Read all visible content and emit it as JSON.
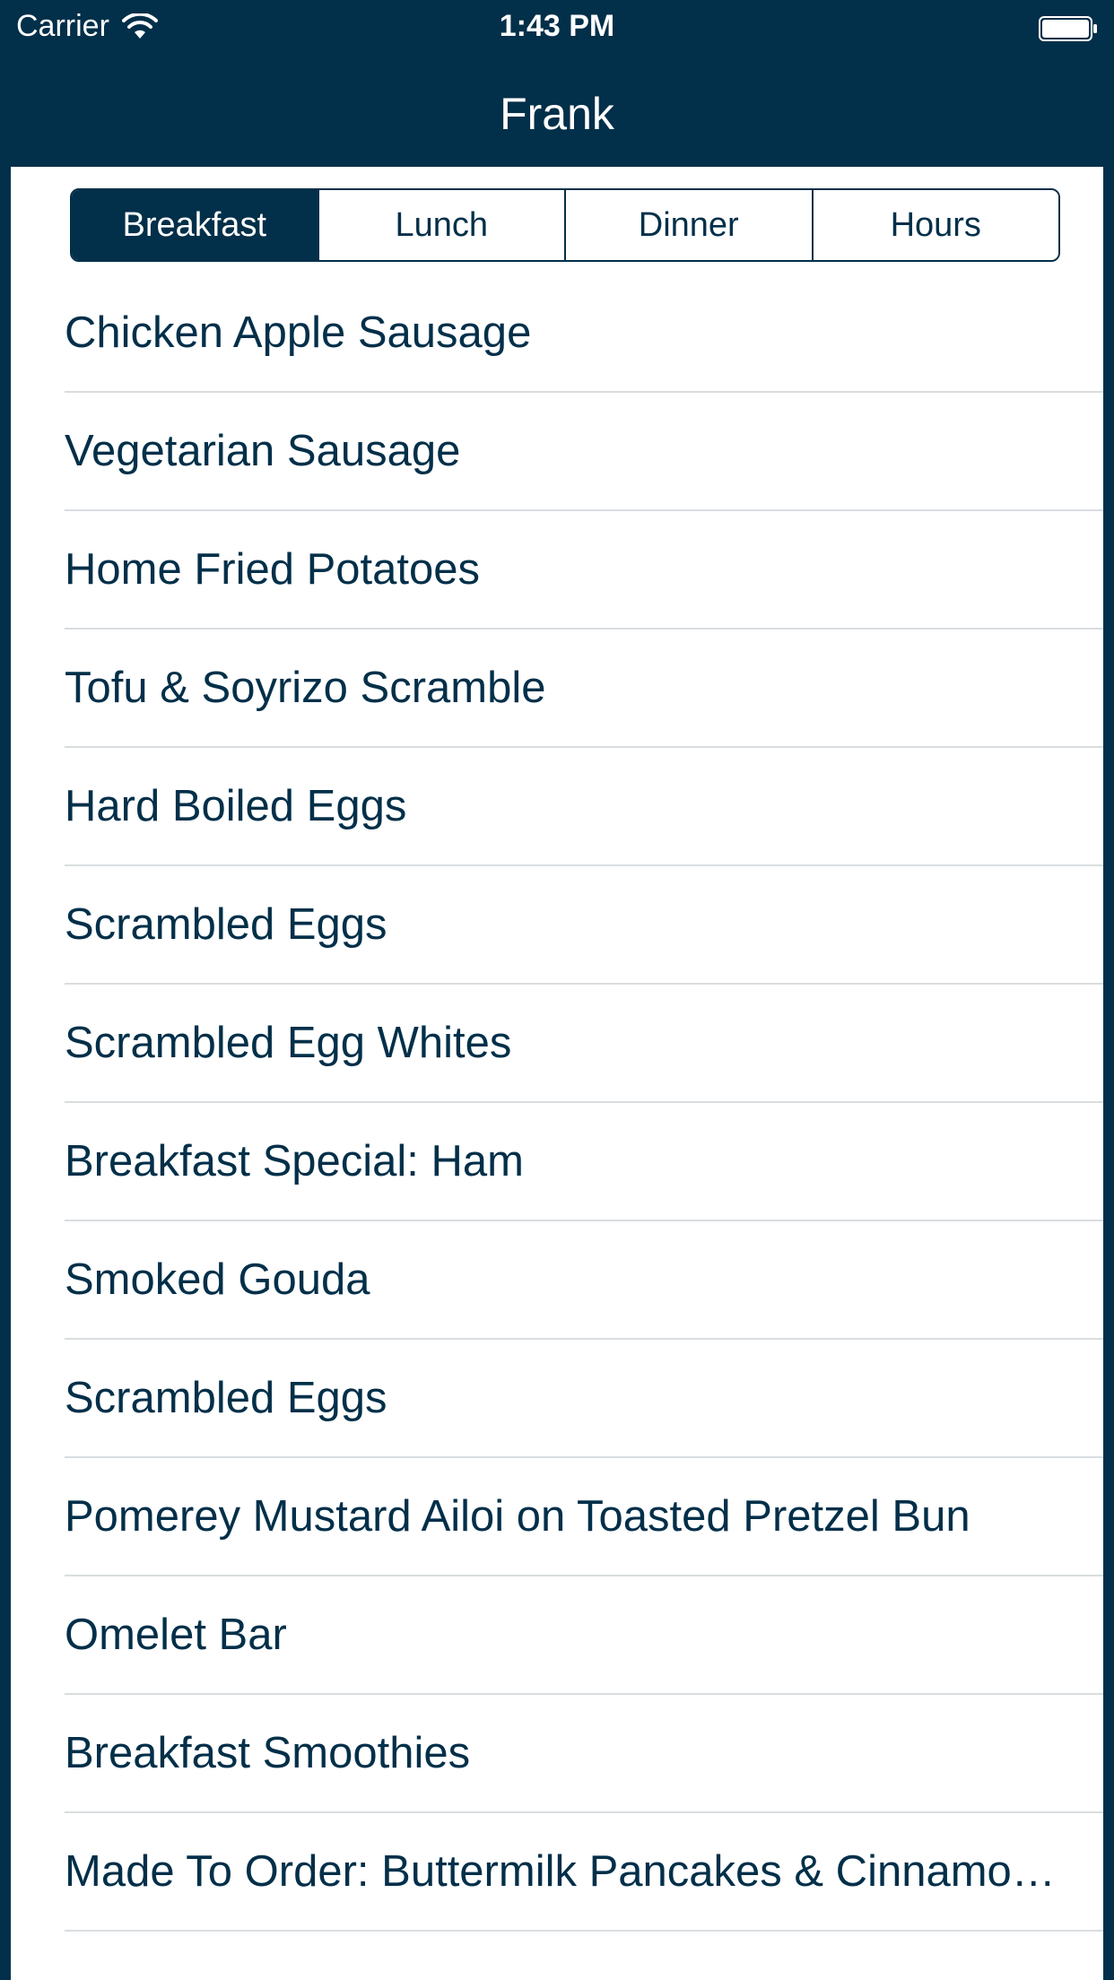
{
  "status_bar": {
    "carrier": "Carrier",
    "time": "1:43 PM",
    "icons": [
      "wifi-icon",
      "battery-icon"
    ]
  },
  "nav": {
    "title": "Frank"
  },
  "segments": [
    {
      "label": "Breakfast",
      "selected": true
    },
    {
      "label": "Lunch",
      "selected": false
    },
    {
      "label": "Dinner",
      "selected": false
    },
    {
      "label": "Hours",
      "selected": false
    }
  ],
  "menu_items": [
    "Chicken Apple Sausage",
    "Vegetarian Sausage",
    "Home Fried Potatoes",
    "Tofu & Soyrizo Scramble",
    "Hard Boiled Eggs",
    "Scrambled Eggs",
    "Scrambled Egg Whites",
    "Breakfast Special: Ham",
    "Smoked Gouda",
    "Scrambled Eggs",
    "Pomerey Mustard Ailoi on Toasted Pretzel Bun",
    "Omelet Bar",
    "Breakfast Smoothies",
    "Made To Order: Buttermilk Pancakes & Cinnamon French Toast"
  ],
  "colors": {
    "brand": "#022f49",
    "background": "#ffffff",
    "separator": "#d9dde0"
  }
}
